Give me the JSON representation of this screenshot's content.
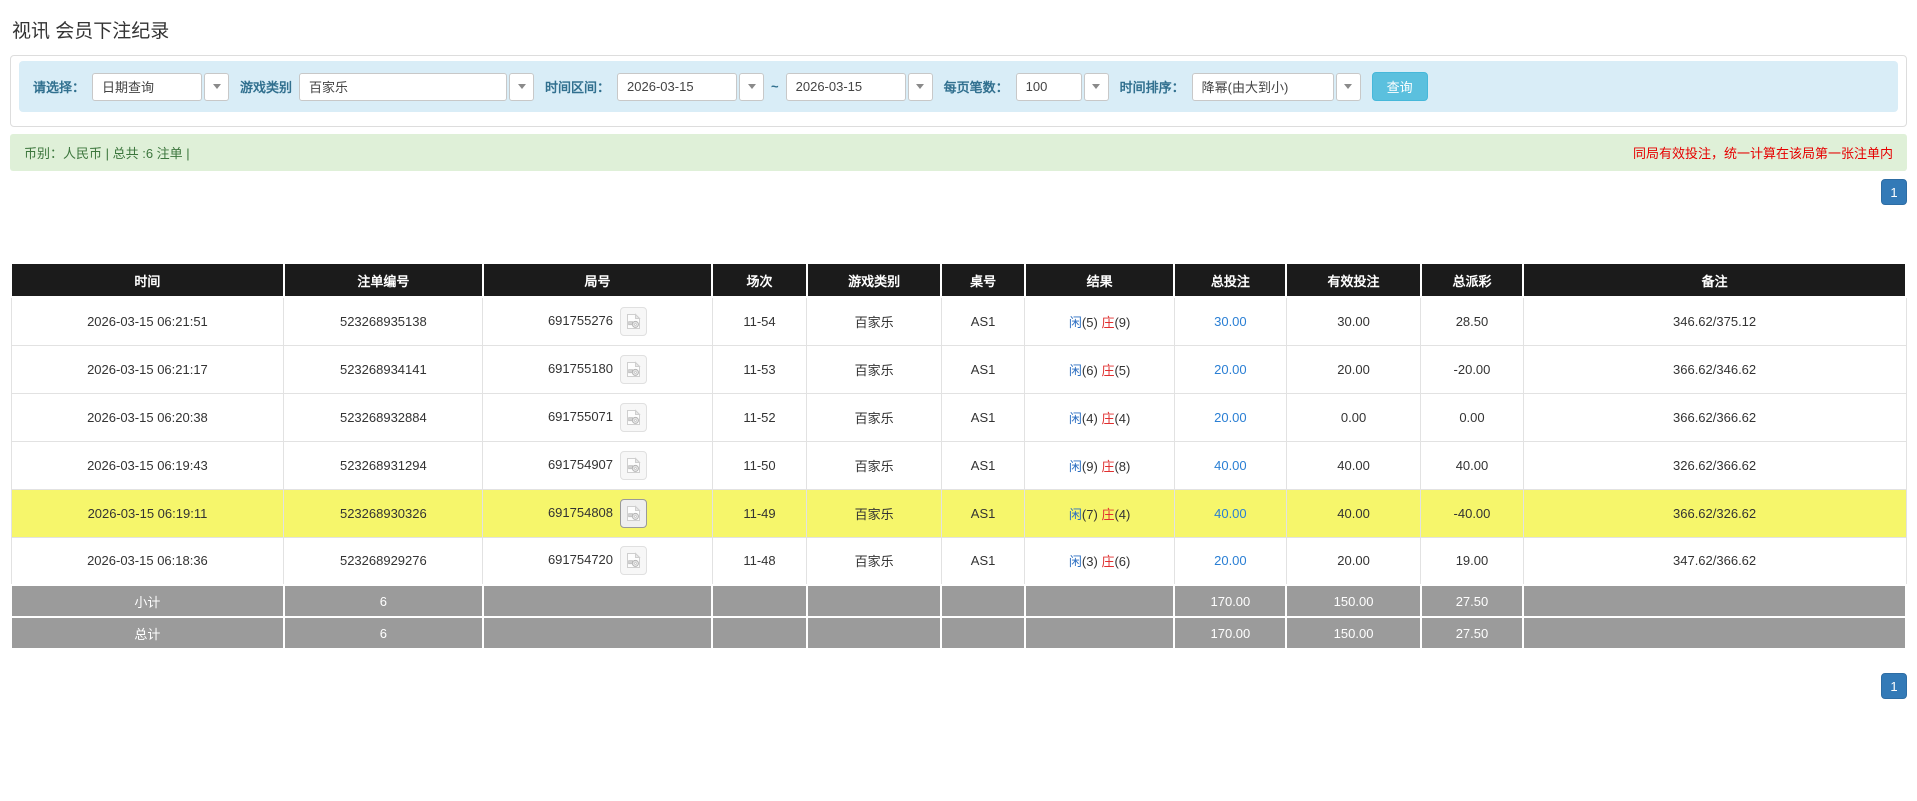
{
  "page": {
    "title": "视讯 会员下注纪录"
  },
  "filters": {
    "select_label": "请选择：",
    "select_value": "日期查询",
    "game_type_label": "游戏类别",
    "game_type_value": "百家乐",
    "time_range_label": "时间区间：",
    "date_from": "2026-03-15",
    "tilde": "~",
    "date_to": "2026-03-15",
    "page_size_label": "每页笔数：",
    "page_size_value": "100",
    "sort_label": "时间排序：",
    "sort_value": "降幂(由大到小)",
    "search_button": "查询"
  },
  "notice": {
    "left": "币别：人民币 | 总共 :6 注单 |",
    "right": "同局有效投注，统一计算在该局第一张注单内"
  },
  "pagination": {
    "page": "1"
  },
  "icons": {
    "combo_arrow": "chevron-down-icon",
    "video_clip": "video-replay-icon"
  },
  "colors": {
    "accent_blue": "#337ab7",
    "search_blue": "#5bc0de",
    "filter_bg": "#d9edf7",
    "notice_bg": "#dff0d8",
    "notice_text": "#3c763d",
    "warning_red": "#e60000",
    "header_black": "#1b1b1b",
    "summary_grey": "#9b9b9b",
    "highlight_yellow": "#f6f66b",
    "link_blue": "#2a7fd4",
    "player_blue": "#2d6fc2",
    "banker_red": "#e03030"
  },
  "table": {
    "headers": [
      "时间",
      "注单编号",
      "局号",
      "场次",
      "游戏类别",
      "桌号",
      "结果",
      "总投注",
      "有效投注",
      "总派彩",
      "备注"
    ],
    "rows": [
      {
        "time": "2026-03-15 06:21:51",
        "bet_id": "523268935138",
        "round_id": "691755276",
        "session": "11-54",
        "game": "百家乐",
        "table_no": "AS1",
        "result": {
          "p": "闲",
          "pn": "(5)",
          "b": "庄",
          "bn": "(9)"
        },
        "total_bet": "30.00",
        "valid_bet": "30.00",
        "payout": "28.50",
        "note": "346.62/375.12"
      },
      {
        "time": "2026-03-15 06:21:17",
        "bet_id": "523268934141",
        "round_id": "691755180",
        "session": "11-53",
        "game": "百家乐",
        "table_no": "AS1",
        "result": {
          "p": "闲",
          "pn": "(6)",
          "b": "庄",
          "bn": "(5)"
        },
        "total_bet": "20.00",
        "valid_bet": "20.00",
        "payout": "-20.00",
        "note": "366.62/346.62"
      },
      {
        "time": "2026-03-15 06:20:38",
        "bet_id": "523268932884",
        "round_id": "691755071",
        "session": "11-52",
        "game": "百家乐",
        "table_no": "AS1",
        "result": {
          "p": "闲",
          "pn": "(4)",
          "b": "庄",
          "bn": "(4)"
        },
        "total_bet": "20.00",
        "valid_bet": "0.00",
        "payout": "0.00",
        "note": "366.62/366.62"
      },
      {
        "time": "2026-03-15 06:19:43",
        "bet_id": "523268931294",
        "round_id": "691754907",
        "session": "11-50",
        "game": "百家乐",
        "table_no": "AS1",
        "result": {
          "p": "闲",
          "pn": "(9)",
          "b": "庄",
          "bn": "(8)"
        },
        "total_bet": "40.00",
        "valid_bet": "40.00",
        "payout": "40.00",
        "note": "326.62/366.62"
      },
      {
        "time": "2026-03-15 06:19:11",
        "bet_id": "523268930326",
        "round_id": "691754808",
        "session": "11-49",
        "game": "百家乐",
        "table_no": "AS1",
        "result": {
          "p": "闲",
          "pn": "(7)",
          "b": "庄",
          "bn": "(4)"
        },
        "total_bet": "40.00",
        "valid_bet": "40.00",
        "payout": "-40.00",
        "note": "366.62/326.62"
      },
      {
        "time": "2026-03-15 06:18:36",
        "bet_id": "523268929276",
        "round_id": "691754720",
        "session": "11-48",
        "game": "百家乐",
        "table_no": "AS1",
        "result": {
          "p": "闲",
          "pn": "(3)",
          "b": "庄",
          "bn": "(6)"
        },
        "total_bet": "20.00",
        "valid_bet": "20.00",
        "payout": "19.00",
        "note": "347.62/366.62"
      }
    ],
    "subtotal": {
      "label": "小计",
      "count": "6",
      "total_bet": "170.00",
      "valid_bet": "150.00",
      "payout": "27.50"
    },
    "grand_total": {
      "label": "总计",
      "count": "6",
      "total_bet": "170.00",
      "valid_bet": "150.00",
      "payout": "27.50"
    }
  }
}
